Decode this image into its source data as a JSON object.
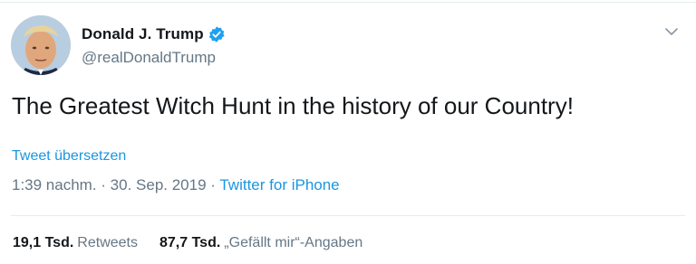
{
  "tweet": {
    "display_name": "Donald J. Trump",
    "handle": "@realDonaldTrump",
    "verified_icon": "verified-badge-icon",
    "menu_icon": "chevron-down-icon",
    "text": "The Greatest Witch Hunt in the history of our Country!",
    "translate_label": "Tweet übersetzen",
    "time": "1:39 nachm.",
    "separator": " · ",
    "date": "30. Sep. 2019",
    "source": "Twitter for iPhone"
  },
  "stats": {
    "retweets_count": "19,1 Tsd.",
    "retweets_label": "Retweets",
    "likes_count": "87,7 Tsd.",
    "likes_label": "„Gefällt mir“-Angaben"
  },
  "colors": {
    "text": "#14171a",
    "secondary": "#657786",
    "link": "#1b95e0",
    "divider": "#e6ecf0",
    "verified": "#1da1f2"
  }
}
